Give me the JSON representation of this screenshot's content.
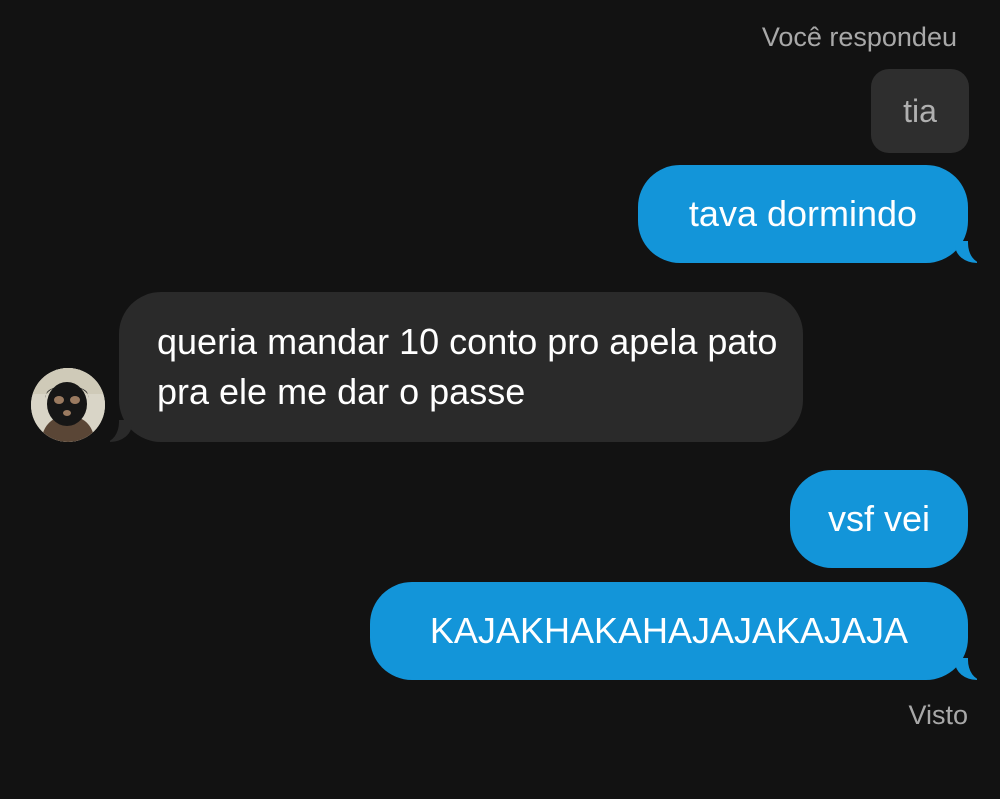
{
  "reply_header": "Você respondeu",
  "quoted_message": "tia",
  "messages": [
    {
      "direction": "outgoing",
      "text": "tava dormindo"
    },
    {
      "direction": "incoming",
      "text": "queria mandar 10 conto pro apela pato pra ele me dar o passe"
    },
    {
      "direction": "outgoing",
      "text": "vsf vei"
    },
    {
      "direction": "outgoing",
      "text": "KAJAKHAKAHAJAJAKAJAJA"
    }
  ],
  "status": "Visto",
  "avatar_icon": "user-avatar-photo",
  "colors": {
    "background": "#121212",
    "outgoing_bubble": "#1395d9",
    "incoming_bubble": "#2a2a2a",
    "quoted_bubble": "#2e2e2e",
    "meta_text": "#a8a8a8"
  }
}
